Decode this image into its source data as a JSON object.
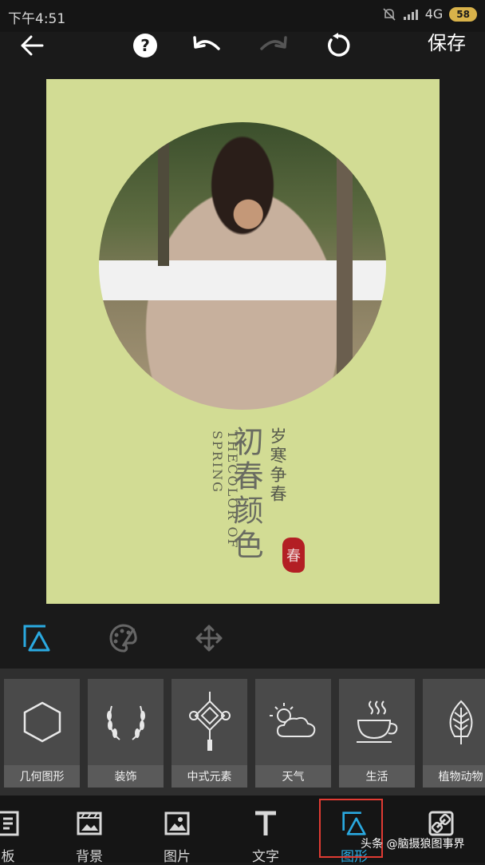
{
  "status_bar": {
    "time": "下午4:51",
    "network": "4G",
    "battery": "58"
  },
  "toolbar": {
    "save_label": "保存"
  },
  "poster": {
    "subtitle_en": "THECOLOR OF SPRING",
    "title_cn": "初春颜色",
    "subtitle_cn": "岁寒争春",
    "seal_char": "春",
    "background_color": "#d2dc94"
  },
  "edit_tools": {
    "items": [
      "shape-tool-icon",
      "palette-icon",
      "move-icon"
    ]
  },
  "categories": {
    "items": [
      {
        "label": "几何图形",
        "icon": "hexagon-icon"
      },
      {
        "label": "装饰",
        "icon": "laurel-icon"
      },
      {
        "label": "中式元素",
        "icon": "chinese-knot-icon"
      },
      {
        "label": "天气",
        "icon": "weather-icon"
      },
      {
        "label": "生活",
        "icon": "coffee-icon"
      },
      {
        "label": "植物动物",
        "icon": "plant-icon"
      }
    ]
  },
  "tabs": {
    "items": [
      {
        "label": "板",
        "icon": "template-icon"
      },
      {
        "label": "背景",
        "icon": "background-icon"
      },
      {
        "label": "图片",
        "icon": "image-icon"
      },
      {
        "label": "文字",
        "icon": "text-icon"
      },
      {
        "label": "图形",
        "icon": "shape-icon"
      },
      {
        "label": "",
        "icon": "link-icon"
      }
    ],
    "active_index": 4
  },
  "watermark": "头条 @脑摄狼图事界",
  "colors": {
    "accent": "#2aa9e0",
    "highlight_box": "#e03b33",
    "panel": "#2f2f2f",
    "tile": "#4a4a4a"
  }
}
